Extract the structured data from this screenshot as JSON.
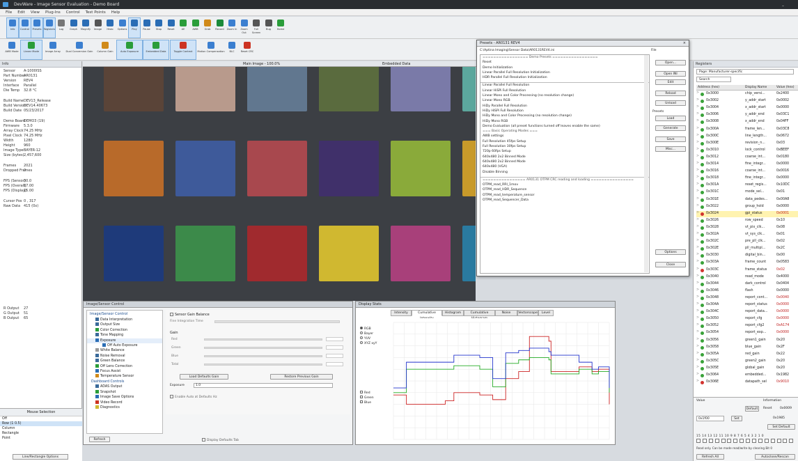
{
  "window": {
    "title": "DevWare - Image Sensor Evaluation - Demo Board"
  },
  "menu": [
    "File",
    "Edit",
    "View",
    "Plug-Ins",
    "Control",
    "Test Points",
    "Help"
  ],
  "toolbar1": [
    {
      "label": "Info"
    },
    {
      "label": "Control"
    },
    {
      "label": "Presets"
    },
    {
      "label": "Registers"
    },
    {
      "label": "Log"
    },
    {
      "label": "Graph"
    },
    {
      "label": "Magnify"
    },
    {
      "label": "Image"
    },
    {
      "label": "Histo"
    },
    {
      "label": "Options"
    },
    {
      "label": "Play"
    },
    {
      "label": "Pause"
    },
    {
      "label": "Stop"
    },
    {
      "label": "Reset"
    },
    {
      "label": "AE"
    },
    {
      "label": "AWB"
    },
    {
      "label": "Grab"
    },
    {
      "label": "Record"
    },
    {
      "label": "Zoom In"
    },
    {
      "label": "Zoom Out"
    },
    {
      "label": "Full Screen"
    },
    {
      "label": "Bug"
    },
    {
      "label": "Home"
    }
  ],
  "toolbar2": [
    {
      "label": "AWB Mode"
    },
    {
      "label": "Linear Mode"
    },
    {
      "label": "Image Array"
    },
    {
      "label": "Dual Conversion Gain"
    },
    {
      "label": "Column Gain"
    },
    {
      "label": "Auto Exposure"
    },
    {
      "label": "Embedded Data"
    },
    {
      "label": "Toggle Context"
    },
    {
      "label": "Motion Compensation"
    },
    {
      "label": "BLC"
    },
    {
      "label": "Reset CRC"
    }
  ],
  "left_panel": {
    "header": "Info",
    "items": [
      {
        "k": "Sensor",
        "v": "A-1000ISS"
      },
      {
        "k": "Part Number",
        "v": "AR0131"
      },
      {
        "k": "Version",
        "v": "REV4"
      },
      {
        "k": "Interface",
        "v": "Parallel"
      },
      {
        "k": "Die Temp",
        "v": "32.8 °C"
      },
      {
        "k": "Build Name",
        "v": "DEV13_Release"
      },
      {
        "k": "Build Version",
        "v": "DEV14.40673"
      },
      {
        "k": "Build Date",
        "v": "05/23/2017"
      },
      {
        "k": "Demo Board",
        "v": "DEMO3 (19)"
      },
      {
        "k": "Firmware",
        "v": "5.3.0"
      },
      {
        "k": "Array Clock",
        "v": "74.25 MHz"
      },
      {
        "k": "Pixel Clock",
        "v": "74.25 MHz"
      },
      {
        "k": "Width",
        "v": "1280"
      },
      {
        "k": "Height",
        "v": "960"
      },
      {
        "k": "Image Type",
        "v": "BAYER-12"
      },
      {
        "k": "Size (bytes)",
        "v": "2,457,600"
      },
      {
        "k": "Frames",
        "v": "2021"
      },
      {
        "k": "Dropped Frames",
        "v": "0"
      },
      {
        "k": "FPS (Sensor)",
        "v": "30.0"
      },
      {
        "k": "FPS (Overall)",
        "v": "17.00"
      },
      {
        "k": "FPS (Display)",
        "v": "15.00"
      },
      {
        "k": "Cursor Pos",
        "v": "0 , 317"
      },
      {
        "k": "Raw Data",
        "v": "415 (0x)"
      },
      {
        "k": "R Output",
        "v": "27"
      },
      {
        "k": "G Output",
        "v": "51"
      },
      {
        "k": "B Output",
        "v": "65"
      }
    ],
    "mouse_header": "Mouse Selection",
    "mouse_items": [
      "Off",
      "Row (1 0.5)",
      "Column",
      "Rectangle",
      "Point"
    ],
    "bottom_btn": "Line/Rectangle Options"
  },
  "viewer": {
    "header_left": "Main Image - 100.0%",
    "header_right": "Embedded Data"
  },
  "control_panel": {
    "title": "Image/Sensor Control",
    "tree_header": "Image/Sensor Control",
    "tree": [
      "Data Interpretation",
      "Output Size",
      "Color Correction",
      "Tone Mapping",
      "Exposure",
      "Off Auto Exposure",
      "White Balance",
      "Noise Removal",
      "Green Balance",
      "Off Lens Correction",
      "Focus Assist",
      "Temperature Sensor",
      "Dashboard Controls",
      "ADAS Output",
      "Snapshot",
      "Image Save Options",
      "Video Record",
      "Diagnostics"
    ],
    "checkbox": "Sensor Gain Balance",
    "field_label": "Fine Integration Time",
    "gain_header": "Gain",
    "gain_rows": [
      "Red",
      "Green",
      "Blue",
      "Total"
    ],
    "btn1": "Load Defaults Gain",
    "btn2": "Restore Previous Gain",
    "exposure_label": "Exposure",
    "exposure_val": "1.0",
    "check2": "Enable Auto at Defaults Hz",
    "refresh": "Refresh",
    "bottom_check": "Display Defaults Tab"
  },
  "stats_panel": {
    "title": "Display Stats",
    "tabs": [
      "Intensity",
      "Cumulative Intensity",
      "Histogram",
      "Cumulative Histogram",
      "Noise",
      "Vectorscope",
      "Level"
    ],
    "legend": [
      "RGB",
      "Bayer",
      "YUV",
      "XYZ xyY"
    ],
    "channels": [
      "Red",
      "Green",
      "Blue"
    ]
  },
  "chart_data": {
    "type": "line",
    "title": "",
    "xlabel": "",
    "ylabel": "",
    "x": [
      0,
      4,
      6,
      10,
      24,
      28,
      35,
      40,
      46,
      52,
      58,
      63,
      66,
      72,
      73,
      78,
      86,
      92,
      95,
      100
    ],
    "series": [
      {
        "name": "Red",
        "color": "#cc2222",
        "values": [
          38,
          38,
          30,
          30,
          33,
          40,
          40,
          38,
          34,
          52,
          58,
          88,
          88,
          84,
          58,
          58,
          62,
          58,
          60,
          30
        ]
      },
      {
        "name": "Green",
        "color": "#22aa22",
        "values": [
          40,
          40,
          60,
          60,
          60,
          63,
          63,
          60,
          45,
          65,
          68,
          70,
          70,
          68,
          56,
          56,
          60,
          56,
          58,
          40
        ]
      },
      {
        "name": "Blue",
        "color": "#2233cc",
        "values": [
          44,
          44,
          66,
          66,
          66,
          72,
          72,
          70,
          52,
          74,
          76,
          78,
          78,
          75,
          72,
          72,
          66,
          60,
          62,
          44
        ]
      }
    ],
    "ylim": [
      0,
      100
    ],
    "grid": true
  },
  "presets": {
    "title": "Presets - AR0131 REV4",
    "path": "C:\\Aptina Imaging\\Sensor Data\\AR0131REV4.ini",
    "file_label": "File",
    "items": [
      "================= Demo Presets =================",
      "Reset",
      "Demo Initialization",
      "Linear Parallel Full Resolution Initialization",
      "HDR Parallel Full Resolution Initialization",
      "",
      "Linear Parallel Full Resolution",
      "Linear HiSPi Full Resolution",
      "Linear Mono and Color Processing (no resolution change)",
      "Linear Mono RGB",
      "HiDy Parallel Full Resolution",
      "HiDy HiSPi Full Resolution",
      "HiDy Mono and Color Processing (no resolution change)",
      "HiDy Mono RGB",
      "Demo Evaluation (all preset functions turned off leaves enable the same)",
      "",
      "=== Basic Operating Modes ===",
      "AWB settings",
      "Full Resolution 45fps Setup",
      "Full Resolution 30fps Setup",
      "720p 60fps Setup",
      "640x480 2x2 Binned Mode",
      "640x480 2x2 Binned Mode",
      "640x480 (VGA)",
      "Disable Binning",
      "",
      "================ AR0131 OTPM CRC reading and loading ================",
      "OTPM_read_RRI_1mov",
      "OTPM_read_HDR_Sequence",
      "OTPM_read_temperature_sensor",
      "OTPM_read_Sequencer_Data"
    ],
    "buttons": [
      "Open...",
      "Open INI",
      "Edit",
      "Reload",
      "Unload",
      "Presets",
      "Load",
      "Generate",
      "Save",
      "Misc...",
      "Options",
      "Close"
    ]
  },
  "registers": {
    "header": "Registers",
    "page": "Page: Manufacturer-specific",
    "search": "Search",
    "col1": "Address (hex)",
    "col2": "Display Name",
    "col3": "Value (hex)",
    "rows": [
      {
        "a": "0x3000",
        "n": "chip_versi...",
        "v": "0x2400",
        "c": "#3aa23a"
      },
      {
        "a": "0x3002",
        "n": "y_addr_start",
        "v": "0x0002",
        "c": "#3aa23a"
      },
      {
        "a": "0x3004",
        "n": "x_addr_start",
        "v": "0x0000",
        "c": "#3aa23a"
      },
      {
        "a": "0x3006",
        "n": "y_addr_end",
        "v": "0x03C1",
        "c": "#3aa23a"
      },
      {
        "a": "0x3008",
        "n": "x_addr_end",
        "v": "0x04FF",
        "c": "#3aa23a"
      },
      {
        "a": "0x300A",
        "n": "frame_len...",
        "v": "0x03C8",
        "c": "#3aa23a"
      },
      {
        "a": "0x300C",
        "n": "line_length...",
        "v": "0x0672",
        "c": "#3aa23a"
      },
      {
        "a": "0x300E",
        "n": "revision_n...",
        "v": "0x03",
        "c": "#3aa23a"
      },
      {
        "a": "0x3010",
        "n": "lock_control",
        "v": "0xBEEF",
        "c": "#3aa23a"
      },
      {
        "a": "0x3012",
        "n": "coarse_int...",
        "v": "0x0180",
        "c": "#3aa23a"
      },
      {
        "a": "0x3014",
        "n": "fine_integr...",
        "v": "0x0000",
        "c": "#3aa23a"
      },
      {
        "a": "0x3016",
        "n": "coarse_int...",
        "v": "0x0016",
        "c": "#3aa23a"
      },
      {
        "a": "0x3018",
        "n": "fine_integr...",
        "v": "0x0000",
        "c": "#3aa23a"
      },
      {
        "a": "0x301A",
        "n": "reset_regis...",
        "v": "0x10DC",
        "c": "#3aa23a"
      },
      {
        "a": "0x301C",
        "n": "mode_sel...",
        "v": "0x01",
        "c": "#3aa23a"
      },
      {
        "a": "0x301E",
        "n": "data_pedes...",
        "v": "0x00A8",
        "c": "#3aa23a"
      },
      {
        "a": "0x3022",
        "n": "group_hold",
        "v": "0x0000",
        "c": "#3aa23a"
      },
      {
        "a": "0x3024",
        "n": "gpi_status",
        "v": "0x0001",
        "c": "#d2332f"
      },
      {
        "a": "0x3026",
        "n": "row_speed",
        "v": "0x10",
        "c": "#3aa23a"
      },
      {
        "a": "0x3028",
        "n": "vt_pix_clk...",
        "v": "0x08",
        "c": "#3aa23a"
      },
      {
        "a": "0x302A",
        "n": "vt_sys_clk...",
        "v": "0x01",
        "c": "#3aa23a"
      },
      {
        "a": "0x302C",
        "n": "pre_pll_clk...",
        "v": "0x02",
        "c": "#3aa23a"
      },
      {
        "a": "0x302E",
        "n": "pll_multipl...",
        "v": "0x2C",
        "c": "#3aa23a"
      },
      {
        "a": "0x3030",
        "n": "digital_bin...",
        "v": "0x00",
        "c": "#3aa23a"
      },
      {
        "a": "0x303A",
        "n": "frame_count",
        "v": "0x0583",
        "c": "#3aa23a"
      },
      {
        "a": "0x303C",
        "n": "frame_status",
        "v": "0x02",
        "c": "#d2332f"
      },
      {
        "a": "0x3040",
        "n": "read_mode",
        "v": "0x4000",
        "c": "#3aa23a"
      },
      {
        "a": "0x3044",
        "n": "dark_control",
        "v": "0x0404",
        "c": "#3aa23a"
      },
      {
        "a": "0x3046",
        "n": "flash",
        "v": "0x0000",
        "c": "#3aa23a"
      },
      {
        "a": "0x3048",
        "n": "report_cont...",
        "v": "0x0040",
        "c": "#3aa23a"
      },
      {
        "a": "0x304A",
        "n": "report_status",
        "v": "0x0000",
        "c": "#3aa23a"
      },
      {
        "a": "0x304C",
        "n": "report_data...",
        "v": "0x0000",
        "c": "#3aa23a"
      },
      {
        "a": "0x3050",
        "n": "report_cfg",
        "v": "0x0000",
        "c": "#3aa23a"
      },
      {
        "a": "0x3052",
        "n": "report_cfg2",
        "v": "0xA174",
        "c": "#3aa23a"
      },
      {
        "a": "0x3054",
        "n": "report_exp...",
        "v": "0x0000",
        "c": "#3aa23a"
      },
      {
        "a": "0x3056",
        "n": "green1_gain",
        "v": "0x20",
        "c": "#3aa23a"
      },
      {
        "a": "0x3058",
        "n": "blue_gain",
        "v": "0x2F",
        "c": "#3aa23a"
      },
      {
        "a": "0x305A",
        "n": "red_gain",
        "v": "0x22",
        "c": "#3aa23a"
      },
      {
        "a": "0x305C",
        "n": "green2_gain",
        "v": "0x20",
        "c": "#3aa23a"
      },
      {
        "a": "0x305E",
        "n": "global_gain",
        "v": "0x20",
        "c": "#3aa23a"
      },
      {
        "a": "0x3064",
        "n": "embedded...",
        "v": "0x1982",
        "c": "#3aa23a"
      },
      {
        "a": "0x306E",
        "n": "datapath_sel",
        "v": "0x9010",
        "c": "#d2332f"
      }
    ],
    "value_label": "Value",
    "value_field": "0x1f00",
    "info_label": "Information",
    "default_label": "Default",
    "default_val": "0x0009",
    "reset_label": "Reset",
    "reset_val": "0x0000",
    "set_label": "Set",
    "set_val": "0x1985",
    "set_default": "Set Default",
    "bits": "15 14 13 12 11 10 9 8 7 6 5 4 3 2 1 0",
    "footer": "Read only. Can be made read/write by clearing Bit 0",
    "bottom_btns": [
      "Refresh All",
      "Autoclose/Rescan"
    ]
  }
}
